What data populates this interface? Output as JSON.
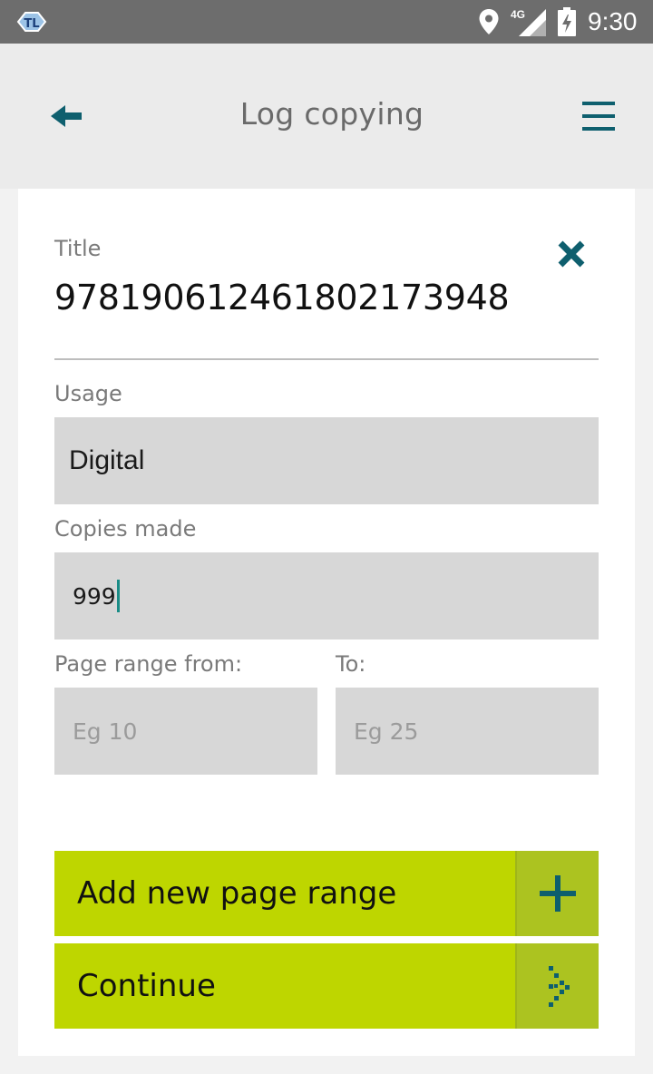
{
  "status_bar": {
    "network": "4G",
    "time": "9:30",
    "icons": [
      "app-logo-icon",
      "location-icon",
      "signal-icon",
      "battery-charging-icon"
    ]
  },
  "app_bar": {
    "title": "Log copying",
    "back_icon": "back-arrow-icon",
    "menu_icon": "hamburger-menu-icon"
  },
  "form": {
    "title_label": "Title",
    "title_value": "97819061246180217394​8",
    "clear_icon": "close-icon",
    "usage_label": "Usage",
    "usage_value": "Digital",
    "copies_label": "Copies made",
    "copies_value": "999",
    "page_from_label": "Page range from:",
    "page_from_placeholder": "Eg 10",
    "page_to_label": "To:",
    "page_to_placeholder": "Eg 25"
  },
  "buttons": {
    "add_range_label": "Add new page range",
    "add_range_icon": "plus-icon",
    "continue_label": "Continue",
    "continue_icon": "dotted-arrow-icon"
  },
  "colors": {
    "accent": "#0e5f6e",
    "button": "#bed600",
    "button_icon_area": "#acc320",
    "status_bar": "#6d6d6d",
    "app_bar": "#ebebeb",
    "field": "#d7d7d7"
  }
}
